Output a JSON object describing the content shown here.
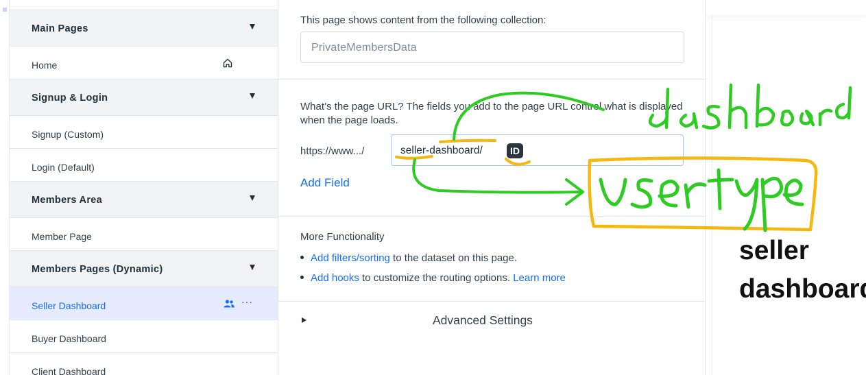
{
  "sidebar": {
    "sections": [
      {
        "title": "Main Pages",
        "items": [
          {
            "label": "Home",
            "icon": "home-icon"
          }
        ]
      },
      {
        "title": "Signup & Login",
        "items": [
          {
            "label": "Signup (Custom)"
          },
          {
            "label": "Login (Default)"
          }
        ]
      },
      {
        "title": "Members Area",
        "items": [
          {
            "label": "Member Page"
          }
        ]
      },
      {
        "title": "Members Pages (Dynamic)",
        "items": [
          {
            "label": "Seller Dashboard",
            "selected": true,
            "icons": [
              "members-icon",
              "more-icon"
            ]
          },
          {
            "label": "Buyer Dashboard"
          },
          {
            "label": "Client Dashboard"
          }
        ]
      }
    ]
  },
  "panel": {
    "collection_caption": "This page shows content from the following collection:",
    "collection_value": "PrivateMembersData",
    "url_caption": "What’s the page URL? The fields you add to the page URL control what is displayed when the page loads.",
    "url_prefix": "https://www.../",
    "url_slug": "seller-dashboard/",
    "url_chip": "ID",
    "add_field": "Add Field",
    "more_title": "More Functionality",
    "bullet1_link": "Add filters/sorting",
    "bullet1_text": " to the dataset on this page.",
    "bullet2_link": "Add hooks",
    "bullet2_text": " to customize the routing options.",
    "bullet2_learn": "Learn more",
    "advanced": "Advanced Settings"
  },
  "preview": {
    "title_line1": "seller",
    "title_line2": "dashboard"
  },
  "annotations": {
    "word_top": "dashboard",
    "word_bottom": "user type"
  },
  "colors": {
    "accent": "#116dff",
    "selected_bg": "#e7ebff",
    "ink_green": "#2ecc23",
    "ink_yellow": "#f5b80f"
  }
}
